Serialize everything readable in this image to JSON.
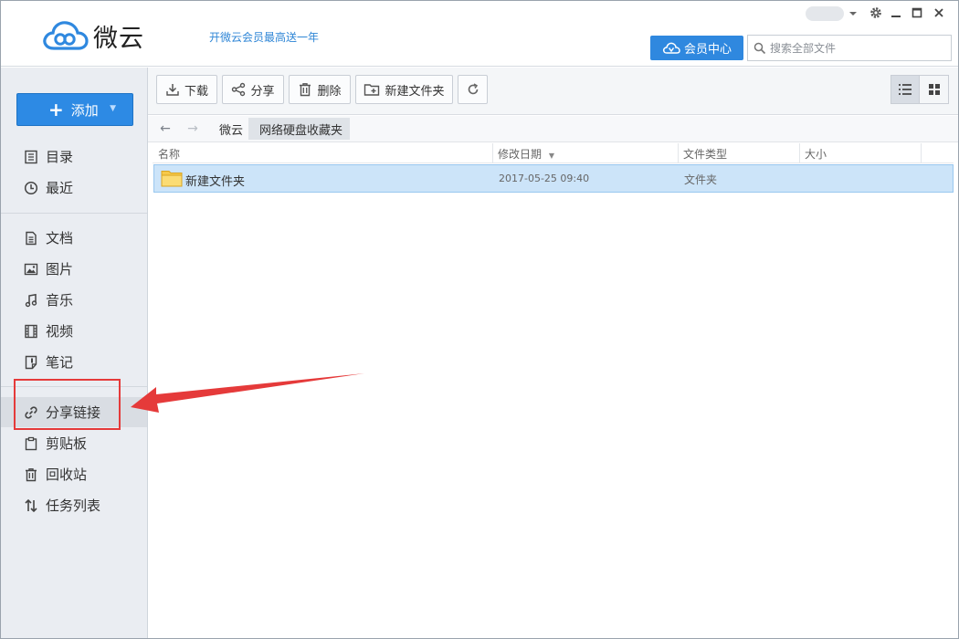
{
  "app": {
    "name": "微云",
    "promo_text": "开微云会员最高送一年",
    "vip_button_label": "会员中心",
    "search_placeholder": "搜索全部文件"
  },
  "sidebar": {
    "add_button_label": "添加",
    "items": [
      {
        "label": "目录",
        "icon": "list-icon"
      },
      {
        "label": "最近",
        "icon": "clock-icon"
      },
      {
        "label": "文档",
        "icon": "document-icon"
      },
      {
        "label": "图片",
        "icon": "image-icon"
      },
      {
        "label": "音乐",
        "icon": "music-icon"
      },
      {
        "label": "视频",
        "icon": "film-icon"
      },
      {
        "label": "笔记",
        "icon": "note-icon"
      },
      {
        "label": "分享链接",
        "icon": "link-icon",
        "active": true
      },
      {
        "label": "剪贴板",
        "icon": "clipboard-icon"
      },
      {
        "label": "回收站",
        "icon": "trash-icon"
      },
      {
        "label": "任务列表",
        "icon": "transfer-icon"
      }
    ]
  },
  "toolbar": {
    "download_label": "下载",
    "share_label": "分享",
    "delete_label": "删除",
    "new_folder_label": "新建文件夹"
  },
  "breadcrumb": {
    "root": "微云",
    "current": "网络硬盘收藏夹"
  },
  "file_list": {
    "columns": {
      "name": "名称",
      "modified": "修改日期",
      "type": "文件类型",
      "size": "大小"
    },
    "rows": [
      {
        "name": "新建文件夹",
        "modified": "2017-05-25 09:40",
        "type": "文件夹",
        "size": ""
      }
    ]
  },
  "colors": {
    "accent": "#2f88df",
    "sidebar_bg": "#eaedf2",
    "selected_row": "#cce4f9",
    "annotation": "#e53a3a"
  }
}
